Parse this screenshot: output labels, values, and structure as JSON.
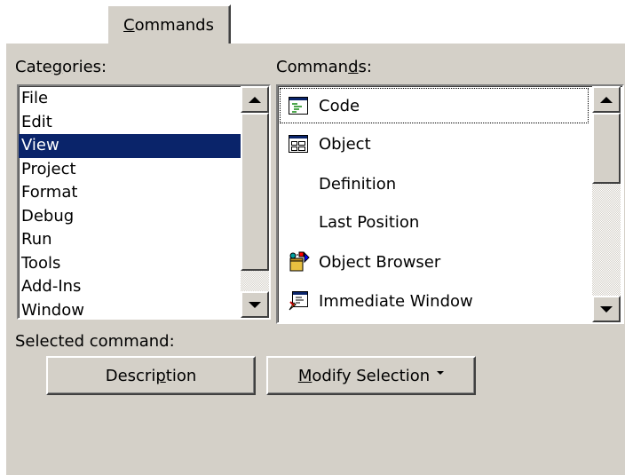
{
  "tab": {
    "pre": "",
    "mnemonic": "C",
    "post": "ommands"
  },
  "categories_label": {
    "pre": "Cate",
    "mnemonic": "g",
    "post": "ories:"
  },
  "categories": [
    "File",
    "Edit",
    "View",
    "Project",
    "Format",
    "Debug",
    "Run",
    "Tools",
    "Add-Ins",
    "Window"
  ],
  "selected_category": "View",
  "commands_label": {
    "pre": "Comman",
    "mnemonic": "d",
    "post": "s:"
  },
  "commands": [
    {
      "label": "Code",
      "icon": "code-window-icon",
      "focused": true
    },
    {
      "label": "Object",
      "icon": "object-form-icon",
      "focused": false
    },
    {
      "label": "Definition",
      "icon": "",
      "focused": false
    },
    {
      "label": "Last Position",
      "icon": "",
      "focused": false
    },
    {
      "label": "Object Browser",
      "icon": "object-browser-icon",
      "focused": false
    },
    {
      "label": "Immediate Window",
      "icon": "immediate-window-icon",
      "focused": false
    }
  ],
  "selected_command_label": "Selected command:",
  "description_button": {
    "pre": "Descri",
    "mnemonic": "p",
    "post": "tion"
  },
  "modify_button": {
    "pre": "",
    "mnemonic": "M",
    "post": "odify Selection"
  },
  "colors": {
    "face": "#d4d0c8",
    "selection": "#0a246a"
  }
}
